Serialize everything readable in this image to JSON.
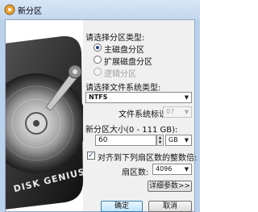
{
  "window": {
    "title": "新分区"
  },
  "partition_type": {
    "label": "请选择分区类型:",
    "options": [
      {
        "label": "主磁盘分区",
        "checked": true,
        "disabled": false
      },
      {
        "label": "扩展磁盘分区",
        "checked": false,
        "disabled": false
      },
      {
        "label": "逻辑分区",
        "checked": false,
        "disabled": true
      }
    ]
  },
  "filesystem": {
    "label": "请选择文件系统类型:",
    "selected": "NTFS",
    "id_label": "文件系统标识:",
    "id_value": "07"
  },
  "size": {
    "label": "新分区大小(0 - 111 GB):",
    "value": "60",
    "unit": "GB"
  },
  "align": {
    "checkbox_label": "对齐到下列扇区数的整数倍:",
    "checked": true,
    "sectors_label": "扇区数:",
    "sectors_value": "4096"
  },
  "buttons": {
    "advanced": "详细参数>>",
    "ok": "确定",
    "cancel": "取消"
  },
  "image": {
    "brand_text": "DISK GENIUS"
  }
}
